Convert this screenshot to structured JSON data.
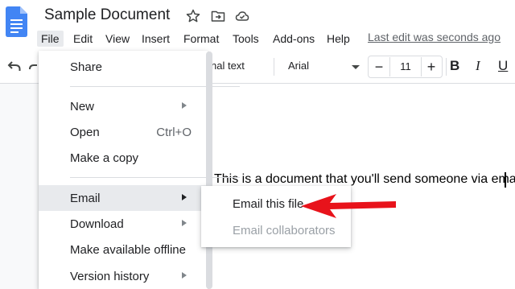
{
  "title_bar": {
    "doc_title": "Sample Document",
    "icons": [
      "star-icon",
      "move-folder-icon",
      "cloud-saved-icon"
    ]
  },
  "menu": {
    "items": [
      "File",
      "Edit",
      "View",
      "Insert",
      "Format",
      "Tools",
      "Add-ons",
      "Help"
    ],
    "last_edit": "Last edit was seconds ago"
  },
  "toolbar": {
    "style_label": "nal text",
    "font_label": "Arial",
    "font_size": "11",
    "minus": "−",
    "plus": "+",
    "bold": "B",
    "italic": "I",
    "underline": "U"
  },
  "document": {
    "text": "This is a document that you'll send someone via email."
  },
  "file_menu": {
    "items": [
      {
        "label": "Share",
        "shortcut": "",
        "submenu": false
      },
      {
        "label": "New",
        "shortcut": "",
        "submenu": true
      },
      {
        "label": "Open",
        "shortcut": "Ctrl+O",
        "submenu": false
      },
      {
        "label": "Make a copy",
        "shortcut": "",
        "submenu": false
      },
      {
        "label": "Email",
        "shortcut": "",
        "submenu": true
      },
      {
        "label": "Download",
        "shortcut": "",
        "submenu": true
      },
      {
        "label": "Make available offline",
        "shortcut": "",
        "submenu": false
      },
      {
        "label": "Version history",
        "shortcut": "",
        "submenu": true
      }
    ],
    "active_item": "Email"
  },
  "email_submenu": {
    "items": [
      {
        "label": "Email this file",
        "enabled": true
      },
      {
        "label": "Email collaborators",
        "enabled": false
      }
    ]
  },
  "colors": {
    "docs_blue": "#4285f4",
    "annotation_red": "#e8131b",
    "disabled_text": "#9aa0a6",
    "menu_highlight": "#e8eaed"
  }
}
